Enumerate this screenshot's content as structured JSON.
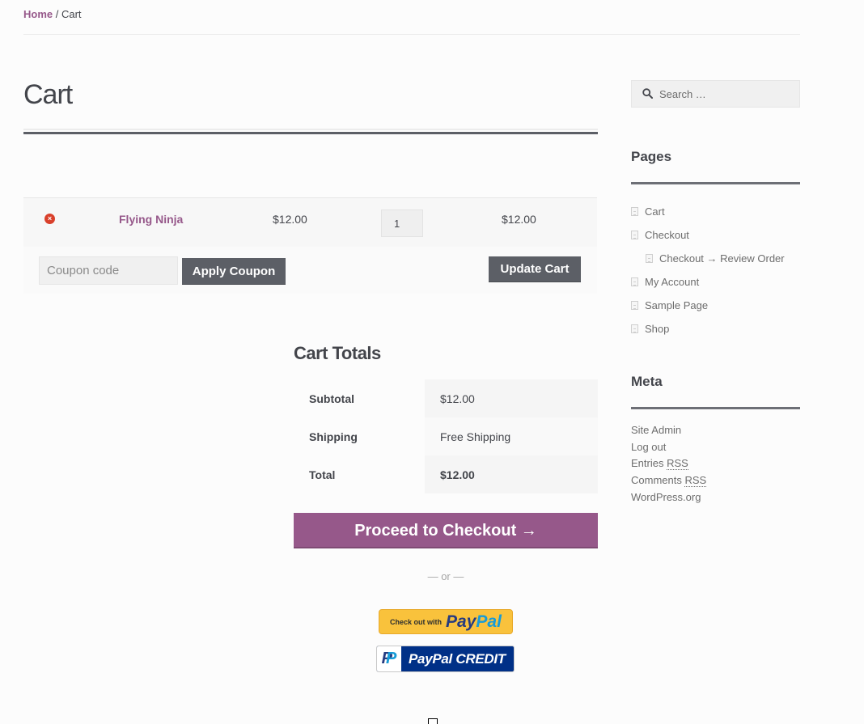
{
  "breadcrumb": {
    "home": "Home",
    "separator": " / ",
    "current": "Cart"
  },
  "page": {
    "title": "Cart"
  },
  "cart": {
    "items": [
      {
        "remove_icon": "×",
        "name": "Flying Ninja",
        "price": "$12.00",
        "quantity": "1",
        "subtotal": "$12.00"
      }
    ],
    "coupon_placeholder": "Coupon code",
    "apply_coupon_label": "Apply Coupon",
    "update_cart_label": "Update Cart"
  },
  "totals": {
    "title": "Cart Totals",
    "rows": [
      {
        "label": "Subtotal",
        "value": "$12.00"
      },
      {
        "label": "Shipping",
        "value": "Free Shipping"
      },
      {
        "label": "Total",
        "value": "$12.00"
      }
    ],
    "checkout_label": "Proceed to Checkout →",
    "or_separator": "— or —",
    "paypal": {
      "prefix": "Check out with",
      "brand_pay": "Pay",
      "brand_pal": "Pal"
    },
    "paypal_credit": {
      "label": "PayPal CREDIT",
      "logo_p1": "P",
      "logo_p2": "P"
    }
  },
  "sidebar": {
    "search_placeholder": "Search …",
    "pages": {
      "title": "Pages",
      "items": [
        {
          "label": "Cart",
          "child": false
        },
        {
          "label": "Checkout",
          "child": false
        },
        {
          "label": "Checkout → Review Order",
          "child": true
        },
        {
          "label": "My Account",
          "child": false
        },
        {
          "label": "Sample Page",
          "child": false
        },
        {
          "label": "Shop",
          "child": false
        }
      ]
    },
    "meta": {
      "title": "Meta",
      "site_admin": "Site Admin",
      "log_out": "Log out",
      "entries_prefix": "Entries ",
      "comments_prefix": "Comments ",
      "rss": "RSS",
      "wordpress": "WordPress.org"
    }
  },
  "colors": {
    "accent": "#96588a",
    "button_dark": "#5c5f66",
    "remove": "#d9402b",
    "paypal_yellow": "#f9c23c",
    "paypal_blue": "#003087"
  }
}
